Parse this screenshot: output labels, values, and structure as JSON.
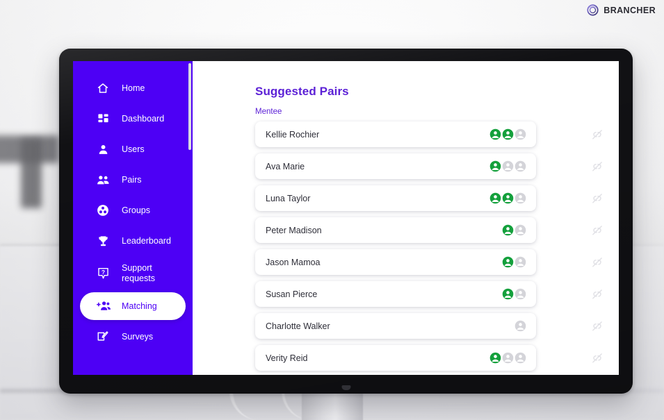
{
  "brand": {
    "name": "BRANCHER",
    "mark_icon": "brancher-circle-logo"
  },
  "sidebar": {
    "background_color": "#4d00f5",
    "items": [
      {
        "label": "Home",
        "icon": "home-icon",
        "active": false
      },
      {
        "label": "Dashboard",
        "icon": "dashboard-grid-icon",
        "active": false
      },
      {
        "label": "Users",
        "icon": "person-icon",
        "active": false
      },
      {
        "label": "Pairs",
        "icon": "people-pair-icon",
        "active": false
      },
      {
        "label": "Groups",
        "icon": "groups-circle-icon",
        "active": false
      },
      {
        "label": "Leaderboard",
        "icon": "trophy-icon",
        "active": false
      },
      {
        "label": "Support requests",
        "icon": "question-help-icon",
        "active": false
      },
      {
        "label": "Matching",
        "icon": "add-people-icon",
        "active": true
      },
      {
        "label": "Surveys",
        "icon": "survey-pencil-icon",
        "active": false
      }
    ]
  },
  "main": {
    "page_title": "Suggested Pairs",
    "title_color": "#5c21d6",
    "section_label": "Mentee",
    "avatar_filled_color": "#14a03c",
    "avatar_empty_color": "#d4d4d9",
    "action_icon": "unlink-broken-chain-icon",
    "rows": [
      {
        "name": "Kellie Rochier",
        "slots": [
          "filled",
          "filled",
          "empty"
        ]
      },
      {
        "name": "Ava Marie",
        "slots": [
          "filled",
          "empty",
          "empty"
        ]
      },
      {
        "name": "Luna Taylor",
        "slots": [
          "filled",
          "filled",
          "empty"
        ]
      },
      {
        "name": "Peter Madison",
        "slots": [
          "filled",
          "empty"
        ]
      },
      {
        "name": "Jason Mamoa",
        "slots": [
          "filled",
          "empty"
        ]
      },
      {
        "name": "Susan Pierce",
        "slots": [
          "filled",
          "empty"
        ]
      },
      {
        "name": "Charlotte Walker",
        "slots": [
          "empty"
        ]
      },
      {
        "name": "Verity Reid",
        "slots": [
          "filled",
          "empty",
          "empty"
        ]
      }
    ]
  }
}
